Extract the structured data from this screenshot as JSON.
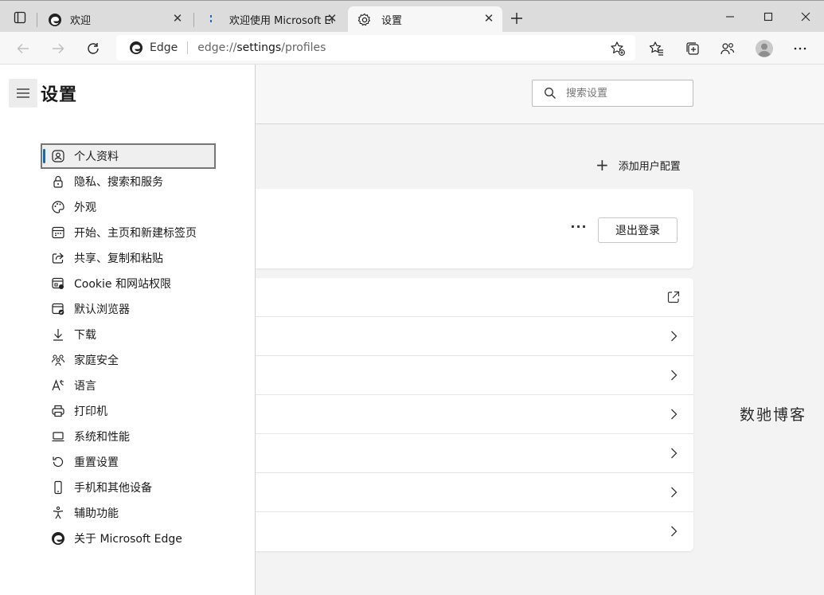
{
  "tabs": [
    {
      "label": "欢迎",
      "close": "✕"
    },
    {
      "label": "欢迎使用 Microsoft Edge",
      "close": "✕"
    },
    {
      "label": "设置",
      "close": "✕"
    }
  ],
  "new_tab": "+",
  "address": {
    "brand": "Edge",
    "url_prefix": "edge://",
    "url_path": "settings",
    "url_suffix": "/profiles"
  },
  "sidebar": {
    "title": "设置",
    "items": [
      {
        "label": "个人资料",
        "icon": "profile-icon",
        "selected": true
      },
      {
        "label": "隐私、搜索和服务",
        "icon": "lock-icon"
      },
      {
        "label": "外观",
        "icon": "palette-icon"
      },
      {
        "label": "开始、主页和新建标签页",
        "icon": "home-page-icon"
      },
      {
        "label": "共享、复制和粘贴",
        "icon": "share-icon"
      },
      {
        "label": "Cookie 和网站权限",
        "icon": "site-permissions-icon"
      },
      {
        "label": "默认浏览器",
        "icon": "default-browser-icon"
      },
      {
        "label": "下载",
        "icon": "download-icon"
      },
      {
        "label": "家庭安全",
        "icon": "family-icon"
      },
      {
        "label": "语言",
        "icon": "language-icon"
      },
      {
        "label": "打印机",
        "icon": "printer-icon"
      },
      {
        "label": "系统和性能",
        "icon": "laptop-icon"
      },
      {
        "label": "重置设置",
        "icon": "reset-icon"
      },
      {
        "label": "手机和其他设备",
        "icon": "phone-icon"
      },
      {
        "label": "辅助功能",
        "icon": "accessibility-icon"
      },
      {
        "label": "关于 Microsoft Edge",
        "icon": "edge-logo-icon"
      }
    ]
  },
  "search": {
    "placeholder": "搜索设置"
  },
  "main": {
    "add_profile_label": "添加用户配置",
    "more_label": "···",
    "signout_label": "退出登录"
  },
  "watermark": "数驰博客",
  "colors": {
    "accent": "#0f6cbd",
    "tabstrip": "#dcdcdc",
    "sidebar_bg": "#ffffff",
    "content_bg": "#f3f3f3"
  }
}
